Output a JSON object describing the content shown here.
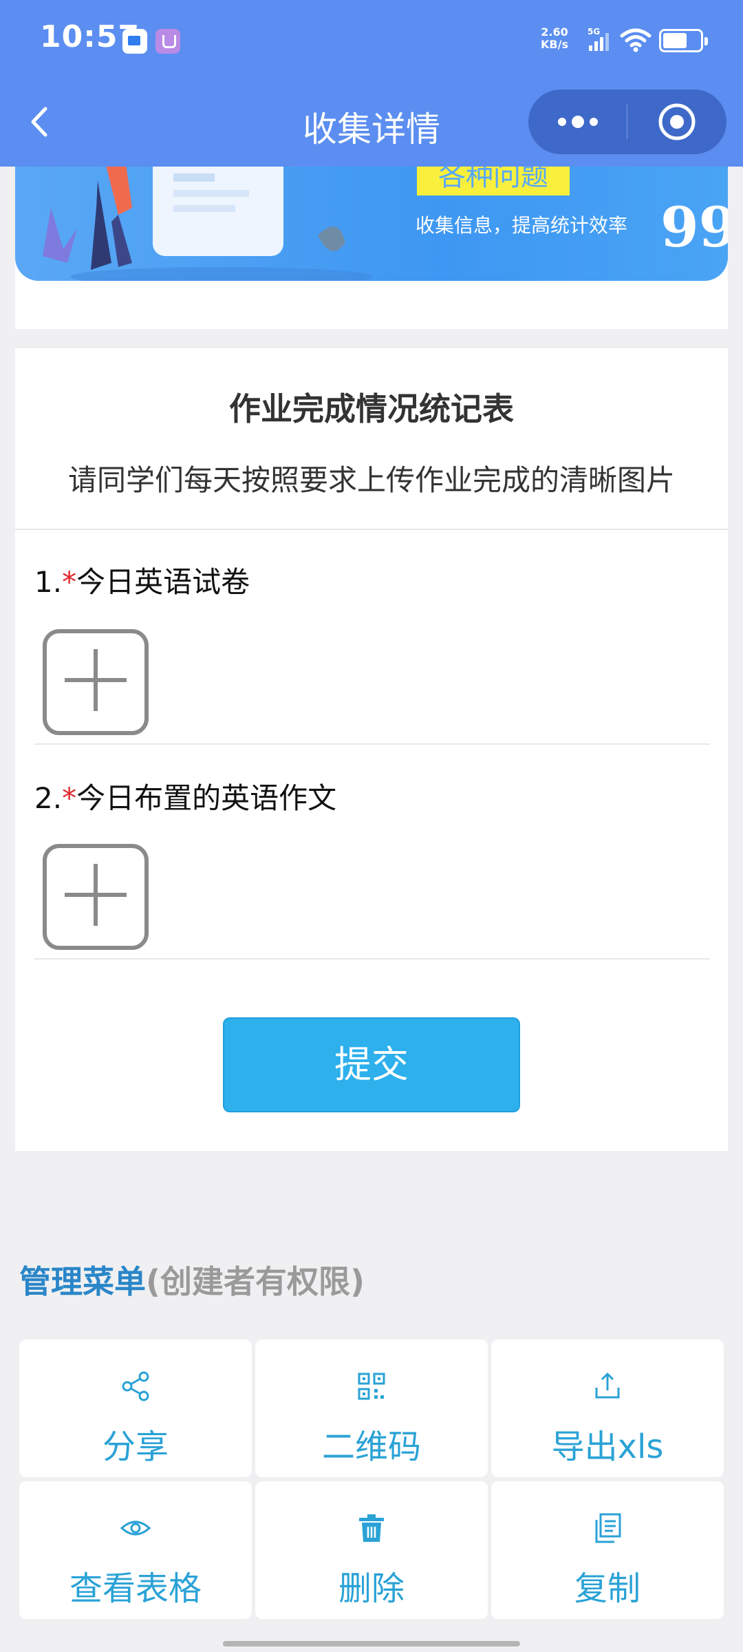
{
  "status_bar": {
    "time": "10:57",
    "net_speed_value": "2.60",
    "net_speed_unit": "KB/s",
    "network_type": "5G",
    "battery_level": 0.65
  },
  "nav": {
    "title": "收集详情",
    "back_icon": "chevron-left-icon",
    "more_icon": "more-dots-icon",
    "close_icon": "target-icon"
  },
  "banner": {
    "tag_text": "各种问题",
    "tagline": "收集信息，提高统计效率",
    "quote_mark": "99"
  },
  "form": {
    "title": "作业完成情况统记表",
    "description": "请同学们每天按照要求上传作业完成的清晰图片",
    "questions": [
      {
        "number": "1.",
        "required_mark": "*",
        "label": "今日英语试卷"
      },
      {
        "number": "2.",
        "required_mark": "*",
        "label": "今日布置的英语作文"
      }
    ],
    "submit_label": "提交"
  },
  "menu": {
    "title": "管理菜单",
    "subtitle": "(创建者有权限)",
    "items": [
      {
        "label": "分享",
        "icon": "share-icon"
      },
      {
        "label": "二维码",
        "icon": "qr-code-icon"
      },
      {
        "label": "导出xls",
        "icon": "export-icon"
      },
      {
        "label": "查看表格",
        "icon": "eye-icon"
      },
      {
        "label": "删除",
        "icon": "trash-icon"
      },
      {
        "label": "复制",
        "icon": "copy-icon"
      }
    ]
  },
  "colors": {
    "header": "#5b8ef0",
    "accent": "#2db0ec",
    "menu_text": "#2aa2d6",
    "required": "#e0262b"
  }
}
